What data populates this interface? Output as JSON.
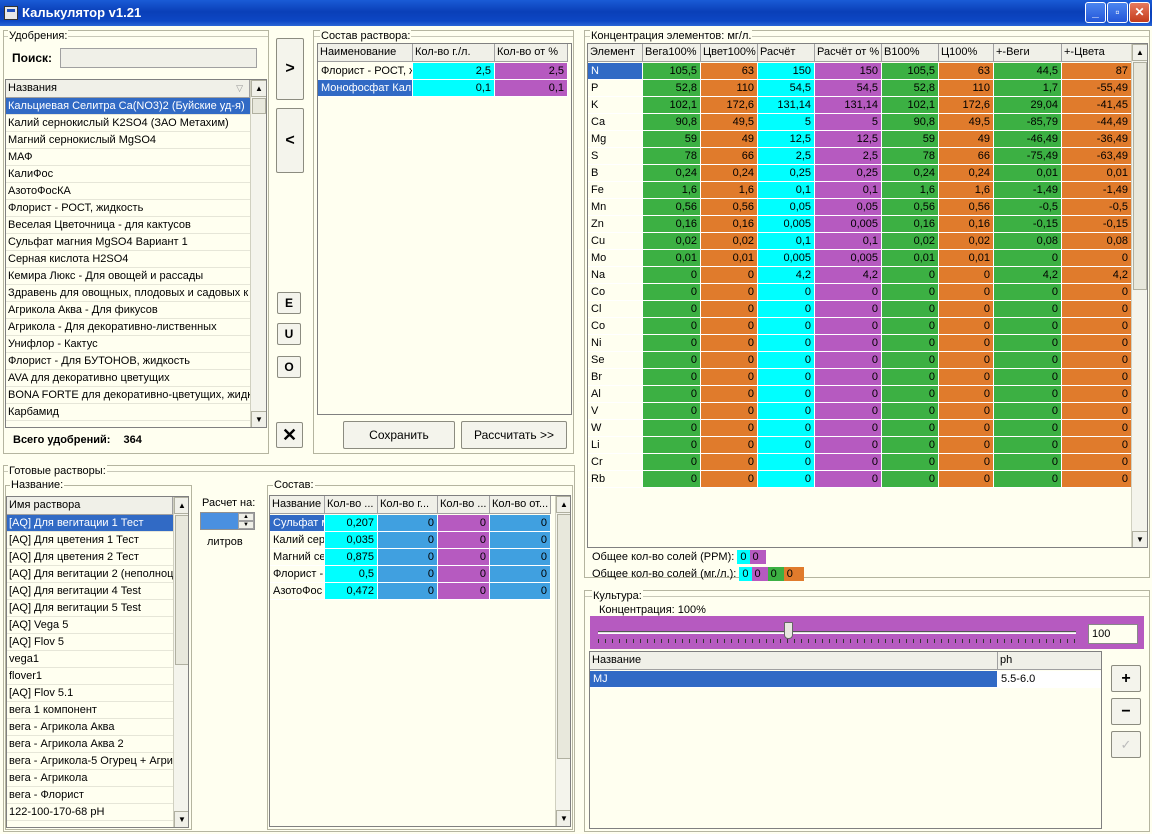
{
  "window": {
    "title": "Калькулятор v1.21"
  },
  "fertilizers": {
    "group_title": "Удобрения:",
    "search_label": "Поиск:",
    "search_value": "",
    "column": "Названия",
    "items": [
      "Кальциевая Селитра Ca(NO3)2 (Буйские уд-я)",
      "Калий  сернокислый  K2SO4 (ЗАО Метахим)",
      "Магний сернокислый MgSO4",
      "МАФ",
      "КалиФос",
      "АзотоФосКА",
      "Флорист - РОСТ, жидкость",
      "Веселая Цветочница - для кактусов",
      "Сульфат магния MgSO4 Вариант 1",
      "Серная кислота H2SO4",
      "Кемира Люкс - Для овощей и рассады",
      "Здравень для овощных, плодовых и садовых к",
      "Агрикола Аква - Для фикусов",
      "Агрикола - Для декоративно-лиственных",
      "Унифлор - Кактус",
      "Флорист - Для БУТОНОВ, жидкость",
      "AVA для декоративно цветущих",
      "BONA FORTE для декоративно-цветущих, жидк",
      "Карбамид"
    ],
    "total_label": "Всего удобрений:",
    "total_value": "364"
  },
  "transfer": {
    "add": ">",
    "remove": "<",
    "e": "E",
    "u": "U",
    "o": "O",
    "clear": "✕"
  },
  "composition": {
    "group_title": "Состав раствора:",
    "columns": [
      "Наименование",
      "Кол-во г./л.",
      "Кол-во от %"
    ],
    "rows": [
      {
        "name": "Флорист - РОСТ, ж",
        "g": "2,5",
        "pct": "2,5"
      },
      {
        "name": "Монофосфат Кали",
        "g": "0,1",
        "pct": "0,1"
      }
    ],
    "save": "Сохранить",
    "calc": "Рассчитать >>"
  },
  "concentration": {
    "group_title": "Концентрация элементов: мг/л.",
    "columns": [
      "Элемент",
      "Вега100%",
      "Цвет100%",
      "Расчёт",
      "Расчёт от %",
      "В100%",
      "Ц100%",
      "+-Веги",
      "+-Цвета"
    ],
    "rows": [
      [
        "N",
        "105,5",
        "63",
        "150",
        "150",
        "105,5",
        "63",
        "44,5",
        "87"
      ],
      [
        "P",
        "52,8",
        "110",
        "54,5",
        "54,5",
        "52,8",
        "110",
        "1,7",
        "-55,49"
      ],
      [
        "K",
        "102,1",
        "172,6",
        "131,14",
        "131,14",
        "102,1",
        "172,6",
        "29,04",
        "-41,45"
      ],
      [
        "Ca",
        "90,8",
        "49,5",
        "5",
        "5",
        "90,8",
        "49,5",
        "-85,79",
        "-44,49"
      ],
      [
        "Mg",
        "59",
        "49",
        "12,5",
        "12,5",
        "59",
        "49",
        "-46,49",
        "-36,49"
      ],
      [
        "S",
        "78",
        "66",
        "2,5",
        "2,5",
        "78",
        "66",
        "-75,49",
        "-63,49"
      ],
      [
        "B",
        "0,24",
        "0,24",
        "0,25",
        "0,25",
        "0,24",
        "0,24",
        "0,01",
        "0,01"
      ],
      [
        "Fe",
        "1,6",
        "1,6",
        "0,1",
        "0,1",
        "1,6",
        "1,6",
        "-1,49",
        "-1,49"
      ],
      [
        "Mn",
        "0,56",
        "0,56",
        "0,05",
        "0,05",
        "0,56",
        "0,56",
        "-0,5",
        "-0,5"
      ],
      [
        "Zn",
        "0,16",
        "0,16",
        "0,005",
        "0,005",
        "0,16",
        "0,16",
        "-0,15",
        "-0,15"
      ],
      [
        "Cu",
        "0,02",
        "0,02",
        "0,1",
        "0,1",
        "0,02",
        "0,02",
        "0,08",
        "0,08"
      ],
      [
        "Mo",
        "0,01",
        "0,01",
        "0,005",
        "0,005",
        "0,01",
        "0,01",
        "0",
        "0"
      ],
      [
        "Na",
        "0",
        "0",
        "4,2",
        "4,2",
        "0",
        "0",
        "4,2",
        "4,2"
      ],
      [
        "Co",
        "0",
        "0",
        "0",
        "0",
        "0",
        "0",
        "0",
        "0"
      ],
      [
        "Cl",
        "0",
        "0",
        "0",
        "0",
        "0",
        "0",
        "0",
        "0"
      ],
      [
        "Co",
        "0",
        "0",
        "0",
        "0",
        "0",
        "0",
        "0",
        "0"
      ],
      [
        "Ni",
        "0",
        "0",
        "0",
        "0",
        "0",
        "0",
        "0",
        "0"
      ],
      [
        "Se",
        "0",
        "0",
        "0",
        "0",
        "0",
        "0",
        "0",
        "0"
      ],
      [
        "Br",
        "0",
        "0",
        "0",
        "0",
        "0",
        "0",
        "0",
        "0"
      ],
      [
        "Al",
        "0",
        "0",
        "0",
        "0",
        "0",
        "0",
        "0",
        "0"
      ],
      [
        "V",
        "0",
        "0",
        "0",
        "0",
        "0",
        "0",
        "0",
        "0"
      ],
      [
        "W",
        "0",
        "0",
        "0",
        "0",
        "0",
        "0",
        "0",
        "0"
      ],
      [
        "Li",
        "0",
        "0",
        "0",
        "0",
        "0",
        "0",
        "0",
        "0"
      ],
      [
        "Cr",
        "0",
        "0",
        "0",
        "0",
        "0",
        "0",
        "0",
        "0"
      ],
      [
        "Rb",
        "0",
        "0",
        "0",
        "0",
        "0",
        "0",
        "0",
        "0"
      ]
    ],
    "salts_ppm_label": "Общее кол-во солей (PPM):",
    "salts_ppm": [
      "0",
      "0"
    ],
    "salts_mgl_label": "Общее кол-во солей (мг./л.):",
    "salts_mgl": [
      "0",
      "0",
      "0",
      "0"
    ]
  },
  "colors": {
    "green": "#3cb043",
    "orange": "#e07b2c",
    "cyan": "#00ffff",
    "magenta": "#b65ac0",
    "blue": "#40a0e0",
    "selection": "#316ac5"
  },
  "ready": {
    "group_title": "Готовые растворы:",
    "name_title": "Название:",
    "column": "Имя раствора",
    "items": [
      "[AQ] Для вегитации 1 Тест",
      "[AQ] Для цветения 1 Тест",
      "[AQ] Для цветения 2 Тест",
      "[AQ] Для вегитации 2 (неполноц",
      "[AQ] Для вегитации 4 Test",
      "[AQ] Для вегитации 5 Test",
      "[AQ] Vega 5",
      "[AQ] Flov 5",
      "vega1",
      "flover1",
      "[AQ] Flov 5.1",
      "вега 1 компонент",
      "вега - Агрикола Аква",
      "вега - Агрикола Аква 2",
      "вега - Агрикола-5 Огурец + Агри",
      "вега - Агрикола",
      "вега - Флорист",
      "122-100-170-68 pH"
    ],
    "calc_for_label": "Расчет на:",
    "calc_for_value": "",
    "liters_label": "литров"
  },
  "ready_composition": {
    "group_title": "Состав:",
    "columns": [
      "Название",
      "Кол-во ...",
      "Кол-во г...",
      "Кол-во ...",
      "Кол-во от..."
    ],
    "rows": [
      [
        "Сульфат м",
        "0,207",
        "0",
        "0",
        "0"
      ],
      [
        "Калий  сер",
        "0,035",
        "0",
        "0",
        "0"
      ],
      [
        "Магний се",
        "0,875",
        "0",
        "0",
        "0"
      ],
      [
        "Флорист -",
        "0,5",
        "0",
        "0",
        "0"
      ],
      [
        "АзотоФос",
        "0,472",
        "0",
        "0",
        "0"
      ]
    ]
  },
  "culture": {
    "group_title": "Культура:",
    "concentration_title": "Концентрация: 100%",
    "slider_value": 100,
    "slider_text": "100",
    "columns": [
      "Название",
      "ph"
    ],
    "rows": [
      {
        "name": "MJ",
        "ph": "5.5-6.0"
      }
    ],
    "add": "+",
    "remove": "−",
    "edit": "✓"
  }
}
